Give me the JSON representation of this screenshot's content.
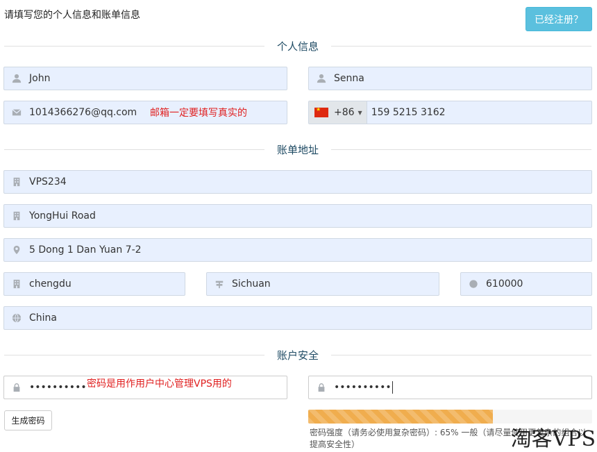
{
  "header": {
    "intro": "请填写您的个人信息和账单信息",
    "login_button": "已经注册？"
  },
  "sections": {
    "personal": "个人信息",
    "billing": "账单地址",
    "security": "账户安全"
  },
  "personal": {
    "first_name": "John",
    "last_name": "Senna",
    "email": "1014366276@qq.com",
    "email_note": "邮箱一定要填写真实的",
    "phone_code": "+86",
    "phone": "159 5215 3162"
  },
  "billing": {
    "company": "VPS234",
    "address1": "YongHui Road",
    "address2": "5 Dong 1 Dan Yuan 7-2",
    "city": "chengdu",
    "state": "Sichuan",
    "postcode": "610000",
    "country": "China"
  },
  "security": {
    "password": "••••••••••",
    "password_note": "密码是用作用户中心管理VPS用的",
    "password_confirm": "••••••••••",
    "generate_button": "生成密码",
    "strength_percent": 65,
    "strength_text": "密码强度（请务必使用复杂密码）: 65% 一般（请尽量使用更复杂的组合以提高安全性）"
  },
  "watermark": "淘客VPS",
  "icons": [
    "user-icon",
    "envelope-icon",
    "building-icon",
    "map-marker-icon",
    "road-icon",
    "circle-icon",
    "globe-icon",
    "lock-icon"
  ],
  "colors": {
    "accent": "#5bc0de",
    "field_bg": "#e8f0fe",
    "note": "#e02020",
    "strength": "#f0ad4e"
  }
}
